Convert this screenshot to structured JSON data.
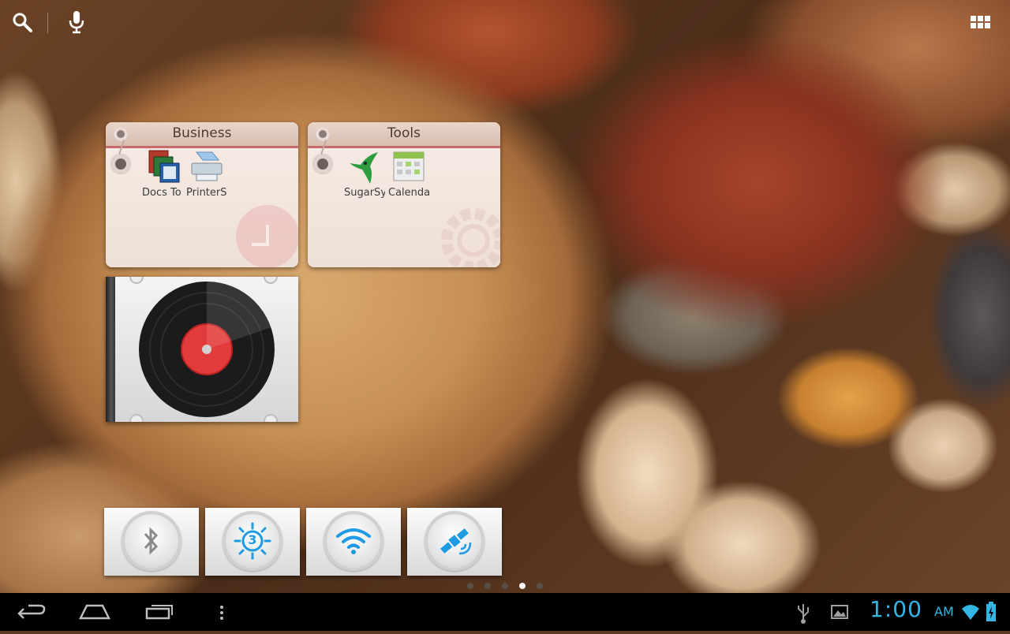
{
  "top_bar": {
    "search_icon": "search-icon",
    "voice_icon": "microphone-icon",
    "apps_icon": "all-apps-grid-icon"
  },
  "folders": [
    {
      "title": "Business",
      "apps": [
        {
          "label": "Docs To Go",
          "icon": "docs-to-go-icon"
        },
        {
          "label": "PrinterShare",
          "icon": "printer-icon"
        }
      ]
    },
    {
      "title": "Tools",
      "apps": [
        {
          "label": "SugarSync",
          "icon": "hummingbird-icon"
        },
        {
          "label": "Calendar",
          "icon": "calendar-icon"
        }
      ]
    }
  ],
  "music_widget": {
    "icon": "vinyl-record-icon"
  },
  "quick_toggles": [
    {
      "name": "bluetooth",
      "icon": "bluetooth-icon",
      "state": "off"
    },
    {
      "name": "brightness",
      "icon": "brightness-icon",
      "value": "3",
      "state": "on"
    },
    {
      "name": "wifi",
      "icon": "wifi-icon",
      "state": "on"
    },
    {
      "name": "gps",
      "icon": "gps-satellite-icon",
      "state": "on"
    }
  ],
  "page_indicator": {
    "pages": 5,
    "active": 4
  },
  "nav_bar": {
    "back_icon": "back-icon",
    "home_icon": "home-icon",
    "recents_icon": "recent-apps-icon",
    "menu_icon": "menu-icon"
  },
  "status": {
    "time": "1:00",
    "ampm": "AM",
    "icons": [
      "usb-icon",
      "image-notification-icon",
      "wifi-signal-icon",
      "battery-charging-icon"
    ]
  },
  "colors": {
    "accent": "#33b5e5",
    "folder_tab_line": "#c86a6a",
    "nav_bg": "#000000"
  }
}
